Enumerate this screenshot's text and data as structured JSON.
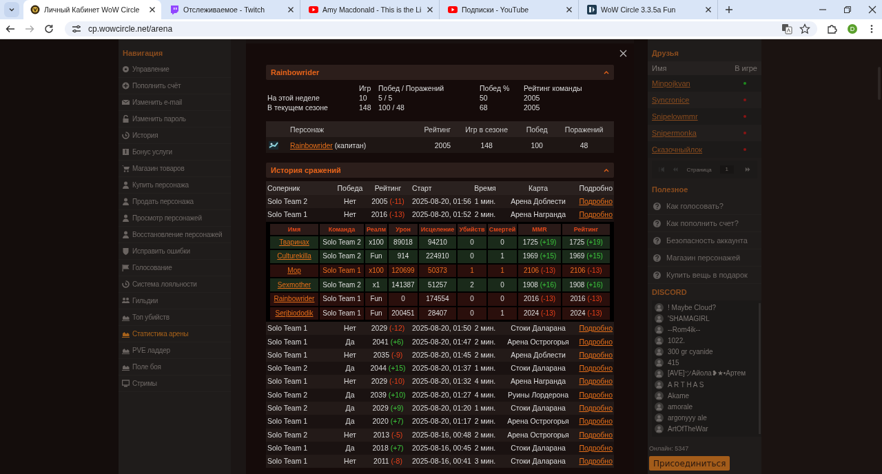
{
  "browser": {
    "tabs": [
      {
        "title": "Личный Кабинет WoW Circle",
        "kind": "wow",
        "selected": true
      },
      {
        "title": "Отслеживаемое - Twitch",
        "kind": "twitch",
        "selected": false
      },
      {
        "title": "Amy Macdonald - This is the Li",
        "kind": "youtube",
        "selected": false
      },
      {
        "title": "Подписки - YouTube",
        "kind": "youtube",
        "selected": false
      },
      {
        "title": "WoW Circle 3.3.5a Fun",
        "kind": "circle",
        "selected": false
      }
    ],
    "url": "cp.wowcircle.net/arena",
    "profile": "D"
  },
  "nav": {
    "title": "Навигация",
    "items": [
      {
        "label": "Управление",
        "selected": false
      },
      {
        "label": "Пополнить счёт",
        "selected": false
      },
      {
        "label": "Изменить e-mail",
        "selected": false
      },
      {
        "label": "Изменить пароль",
        "selected": false
      },
      {
        "label": "История",
        "selected": false
      },
      {
        "label": "Бонус услуги",
        "selected": false
      },
      {
        "label": "Магазин товаров",
        "selected": false
      },
      {
        "label": "Купить персонажа",
        "selected": false
      },
      {
        "label": "Продать персонажа",
        "selected": false
      },
      {
        "label": "Просмотр персонажей",
        "selected": false
      },
      {
        "label": "Восстановление персонажей",
        "selected": false
      },
      {
        "label": "Исправить ошибки",
        "selected": false
      },
      {
        "label": "Голосование",
        "selected": false
      },
      {
        "label": "Система лояльности",
        "selected": false
      },
      {
        "label": "Гильдии",
        "selected": false
      },
      {
        "label": "Топ убийств",
        "selected": false
      },
      {
        "label": "Статистика арены",
        "selected": true
      },
      {
        "label": "PVE ладдер",
        "selected": false
      },
      {
        "label": "Поле боя",
        "selected": false
      },
      {
        "label": "Стримы",
        "selected": false
      }
    ]
  },
  "modal": {
    "team": {
      "title": "Rainbowrider"
    },
    "stats": {
      "columns": [
        "Игр",
        "Побед / Поражений",
        "Побед %",
        "Рейтинг команды"
      ],
      "rows": [
        {
          "label": "На этой неделе",
          "cells": [
            "10",
            "5 / 5",
            "50",
            "2005"
          ]
        },
        {
          "label": "В текущем сезоне",
          "cells": [
            "148",
            "100 / 48",
            "68",
            "2005"
          ]
        }
      ]
    },
    "roster": {
      "columns": [
        "Персонаж",
        "Рейтинг",
        "Игр в сезоне",
        "Побед",
        "Поражений"
      ],
      "rows": [
        {
          "name": "Rainbowrider",
          "note": "(капитан)",
          "rating": "2005",
          "games": "148",
          "wins": "100",
          "losses": "48"
        }
      ]
    },
    "history": {
      "title": "История сражений",
      "columns": [
        "Соперник",
        "Победа",
        "Рейтинг",
        "Старт",
        "Время",
        "Карта",
        "Подробно"
      ],
      "detail_columns": [
        "Имя",
        "Команда",
        "Реалм",
        "Урон",
        "Исцеление",
        "Убийств",
        "Смертей",
        "MMR",
        "Рейтинг"
      ],
      "rows": [
        {
          "opponent": "Solo Team 2",
          "result": "Нет",
          "won": false,
          "rating": "2005",
          "change": "(-11)",
          "start": "2025-08-20, 01:56",
          "time": "1 мин.",
          "map": "Арена Доблести",
          "link": "Подробно"
        },
        {
          "opponent": "Solo Team 1",
          "result": "Нет",
          "won": false,
          "rating": "2016",
          "change": "(-13)",
          "start": "2025-08-20, 01:52",
          "time": "2 мин.",
          "map": "Арена Награнда",
          "link": "Подробно",
          "details": [
            {
              "name": "Тваринах",
              "team": "Solo Team 2",
              "realm": "x100",
              "damage": "89018",
              "healing": "94210",
              "kills": "0",
              "deaths": "0",
              "mmr": "1725",
              "mmr_change": "(+19)",
              "rating": "1725",
              "rating_change": "(+19)",
              "won": true,
              "highlighted": false
            },
            {
              "name": "Culturekilla",
              "team": "Solo Team 2",
              "realm": "Fun",
              "damage": "914",
              "healing": "224910",
              "kills": "0",
              "deaths": "1",
              "mmr": "1969",
              "mmr_change": "(+15)",
              "rating": "1969",
              "rating_change": "(+15)",
              "won": true,
              "highlighted": false
            },
            {
              "name": "Мор",
              "team": "Solo Team 1",
              "realm": "x100",
              "damage": "120699",
              "healing": "50373",
              "kills": "1",
              "deaths": "1",
              "mmr": "2106",
              "mmr_change": "(-13)",
              "rating": "2106",
              "rating_change": "(-13)",
              "won": false,
              "highlighted": true
            },
            {
              "name": "Sexmother",
              "team": "Solo Team 2",
              "realm": "x1",
              "damage": "141387",
              "healing": "51257",
              "kills": "2",
              "deaths": "0",
              "mmr": "1908",
              "mmr_change": "(+16)",
              "rating": "1908",
              "rating_change": "(+16)",
              "won": true,
              "highlighted": false
            },
            {
              "name": "Rainbowrider",
              "team": "Solo Team 1",
              "realm": "Fun",
              "damage": "0",
              "healing": "174554",
              "kills": "0",
              "deaths": "0",
              "mmr": "2016",
              "mmr_change": "(-13)",
              "rating": "2016",
              "rating_change": "(-13)",
              "won": false,
              "highlighted": false
            },
            {
              "name": "Serjbiododik",
              "team": "Solo Team 1",
              "realm": "Fun",
              "damage": "200451",
              "healing": "28407",
              "kills": "0",
              "deaths": "1",
              "mmr": "2024",
              "mmr_change": "(-13)",
              "rating": "2024",
              "rating_change": "(-13)",
              "won": false,
              "highlighted": false
            }
          ]
        },
        {
          "opponent": "Solo Team 1",
          "result": "Нет",
          "won": false,
          "rating": "2029",
          "change": "(-12)",
          "start": "2025-08-20, 01:50",
          "time": "2 мин.",
          "map": "Стоки Даларана",
          "link": "Подробно"
        },
        {
          "opponent": "Solo Team 1",
          "result": "Да",
          "won": true,
          "rating": "2041",
          "change": "(+6)",
          "start": "2025-08-20, 01:47",
          "time": "2 мин.",
          "map": "Арена Острогорья",
          "link": "Подробно"
        },
        {
          "opponent": "Solo Team 1",
          "result": "Нет",
          "won": false,
          "rating": "2035",
          "change": "(-9)",
          "start": "2025-08-20, 01:45",
          "time": "2 мин.",
          "map": "Арена Доблести",
          "link": "Подробно"
        },
        {
          "opponent": "Solo Team 2",
          "result": "Да",
          "won": true,
          "rating": "2044",
          "change": "(+15)",
          "start": "2025-08-20, 01:37",
          "time": "1 мин.",
          "map": "Стоки Даларана",
          "link": "Подробно"
        },
        {
          "opponent": "Solo Team 1",
          "result": "Нет",
          "won": false,
          "rating": "2029",
          "change": "(-10)",
          "start": "2025-08-20, 01:32",
          "time": "4 мин.",
          "map": "Арена Награнда",
          "link": "Подробно"
        },
        {
          "opponent": "Solo Team 2",
          "result": "Да",
          "won": true,
          "rating": "2039",
          "change": "(+10)",
          "start": "2025-08-20, 01:27",
          "time": "4 мин.",
          "map": "Руины Лордерона",
          "link": "Подробно"
        },
        {
          "opponent": "Solo Team 2",
          "result": "Да",
          "won": true,
          "rating": "2029",
          "change": "(+9)",
          "start": "2025-08-20, 01:20",
          "time": "1 мин.",
          "map": "Стоки Даларана",
          "link": "Подробно"
        },
        {
          "opponent": "Solo Team 1",
          "result": "Да",
          "won": true,
          "rating": "2020",
          "change": "(+7)",
          "start": "2025-08-20, 01:17",
          "time": "2 мин.",
          "map": "Арена Острогорья",
          "link": "Подробно"
        },
        {
          "opponent": "Solo Team 2",
          "result": "Нет",
          "won": false,
          "rating": "2013",
          "change": "(-5)",
          "start": "2025-08-16, 00:48",
          "time": "2 мин.",
          "map": "Арена Острогорья",
          "link": "Подробно"
        },
        {
          "opponent": "Solo Team 1",
          "result": "Да",
          "won": true,
          "rating": "2018",
          "change": "(+7)",
          "start": "2025-08-16, 00:45",
          "time": "2 мин.",
          "map": "Стоки Даларана",
          "link": "Подробно"
        },
        {
          "opponent": "Solo Team 1",
          "result": "Нет",
          "won": false,
          "rating": "2011",
          "change": "(-8)",
          "start": "2025-08-16, 00:41",
          "time": "3 мин.",
          "map": "Стоки Даларана",
          "link": "Подробно"
        }
      ]
    }
  },
  "friends": {
    "title": "Друзья",
    "columns": [
      "Имя",
      "В игре"
    ],
    "rows": [
      {
        "name": "Minpojkvan",
        "color": "#1e8a1e"
      },
      {
        "name": "Syncronice",
        "color": "#8a1414"
      },
      {
        "name": "Snipelowmmr",
        "color": "#8a1414"
      },
      {
        "name": "Snipermonka",
        "color": "#8a1414"
      },
      {
        "name": "Сказочныйлок",
        "color": "#8a1414"
      }
    ],
    "pagination": {
      "label": "Страница",
      "page": "1"
    }
  },
  "useful": {
    "title": "Полезное",
    "items": [
      "Как голосовать?",
      "Как пополнить счет?",
      "Безопасность аккаунта",
      "Магазин персонажей",
      "Купить вещь в подарок"
    ]
  },
  "discord": {
    "title": "DISCORD",
    "members": [
      "! Maybe Cloud?",
      "'SHAMAGIRL",
      "--Rom4ik--",
      "1022.",
      "300 gr cyanide",
      "415",
      "[AVE]ツАйола❥★•Артем",
      "A R T H A S",
      "Akame",
      "amorale",
      "argonyyy ale",
      "ArtOfTheWar"
    ],
    "online": "Онлайн: 5347",
    "join": "Присоединиться"
  }
}
